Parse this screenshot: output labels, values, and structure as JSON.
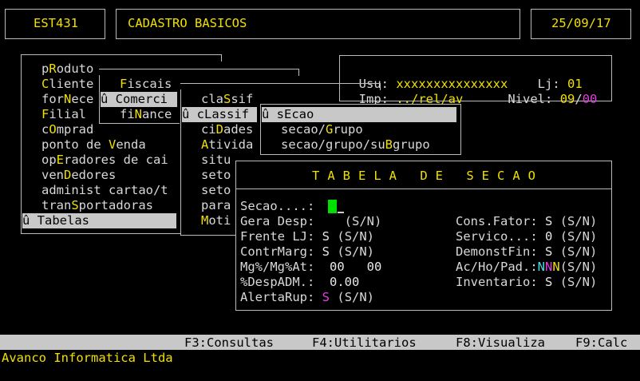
{
  "header": {
    "program_code": "EST431",
    "screen_title": "CADASTRO BASICOS",
    "date": "25/09/17"
  },
  "info": {
    "usu_label": "Usu:",
    "usu_value": "xxxxxxxxxxxxxxx",
    "lj_label": "Lj:",
    "lj_value": "01",
    "imp_label": "Imp:",
    "imp_value": "../rel/av",
    "nivel_label": "Nivel:",
    "nivel_value_a": "09",
    "nivel_sep": "/",
    "nivel_value_b": "00"
  },
  "menu_main": {
    "items": [
      {
        "pre": "p",
        "hot": "R",
        "post": "oduto"
      },
      {
        "pre": "",
        "hot": "C",
        "post": "liente"
      },
      {
        "pre": "for",
        "hot": "N",
        "post": "ece"
      },
      {
        "pre": "",
        "hot": "F",
        "post": "ilial"
      },
      {
        "pre": "c",
        "hot": "O",
        "post": "mprad"
      },
      {
        "pre": "ponto de ",
        "hot": "V",
        "post": "enda"
      },
      {
        "pre": "op",
        "hot": "E",
        "post": "radores de cai"
      },
      {
        "pre": "ven",
        "hot": "D",
        "post": "edores"
      },
      {
        "pre": "administ cartao/t",
        "hot": "",
        "post": ""
      },
      {
        "pre": "tran",
        "hot": "S",
        "post": "portadoras"
      },
      {
        "pre": "û ",
        "hot": "T",
        "post": "abelas"
      }
    ]
  },
  "menu_sub1": {
    "items": [
      {
        "pre": "",
        "hot": "F",
        "post": "iscais"
      },
      {
        "pre": "û ",
        "hot": "C",
        "post": "omerci"
      },
      {
        "pre": "fi",
        "hot": "N",
        "post": "ance"
      }
    ]
  },
  "menu_sub2": {
    "items": [
      {
        "pre": "cla",
        "hot": "S",
        "post": "sif"
      },
      {
        "pre": "û c",
        "hot": "L",
        "post": "assif"
      },
      {
        "pre": "ci",
        "hot": "D",
        "post": "ades"
      },
      {
        "pre": "",
        "hot": "A",
        "post": "tivida"
      },
      {
        "pre": "situ",
        "hot": "",
        "post": ""
      },
      {
        "pre": "seto",
        "hot": "",
        "post": ""
      },
      {
        "pre": "seto",
        "hot": "",
        "post": ""
      },
      {
        "pre": "para",
        "hot": "",
        "post": ""
      },
      {
        "pre": "",
        "hot": "M",
        "post": "oti"
      }
    ]
  },
  "menu_sub3": {
    "items": [
      {
        "pre": "û s",
        "hot": "E",
        "post": "cao"
      },
      {
        "pre": "secao/",
        "hot": "G",
        "post": "rupo"
      },
      {
        "pre": "secao/grupo/su",
        "hot": "B",
        "post": "grupo"
      }
    ]
  },
  "dialog": {
    "title": "TABELA DE SECAO",
    "left_fields": [
      {
        "label": "Secao....:",
        "value": "",
        "hint": ""
      },
      {
        "label": "Gera Desp:",
        "value": "",
        "hint": "(S/N)"
      },
      {
        "label": "Frente LJ:",
        "value": "S",
        "hint": "(S/N)"
      },
      {
        "label": "ContrMarg:",
        "value": "S",
        "hint": "(S/N)"
      },
      {
        "label": "Mg%/Mg%At:",
        "value": "00   00",
        "hint": ""
      },
      {
        "label": "%DespADM.:",
        "value": "0.00",
        "hint": ""
      },
      {
        "label": "AlertaRup:",
        "value": "S",
        "hint": "(S/N)"
      }
    ],
    "right_fields": [
      {
        "label": "Cons.Fator:",
        "value": "S",
        "hint": "(S/N)"
      },
      {
        "label": "Servico...:",
        "value": "0",
        "hint": "(S/N)"
      },
      {
        "label": "DemonstFin:",
        "value": "S",
        "hint": "(S/N)"
      },
      {
        "label": "Ac/Ho/Pad.:",
        "value": "NNN",
        "hint": "(S/N)"
      },
      {
        "label": "Inventario:",
        "value": "S",
        "hint": "(S/N)"
      }
    ]
  },
  "function_bar": {
    "f3": "F3:Consultas",
    "f4": "F4:Utilitarios",
    "f8": "F8:Visualiza",
    "f9": "F9:Calc"
  },
  "footer": {
    "company": "Avanco Informatica Ltda"
  }
}
